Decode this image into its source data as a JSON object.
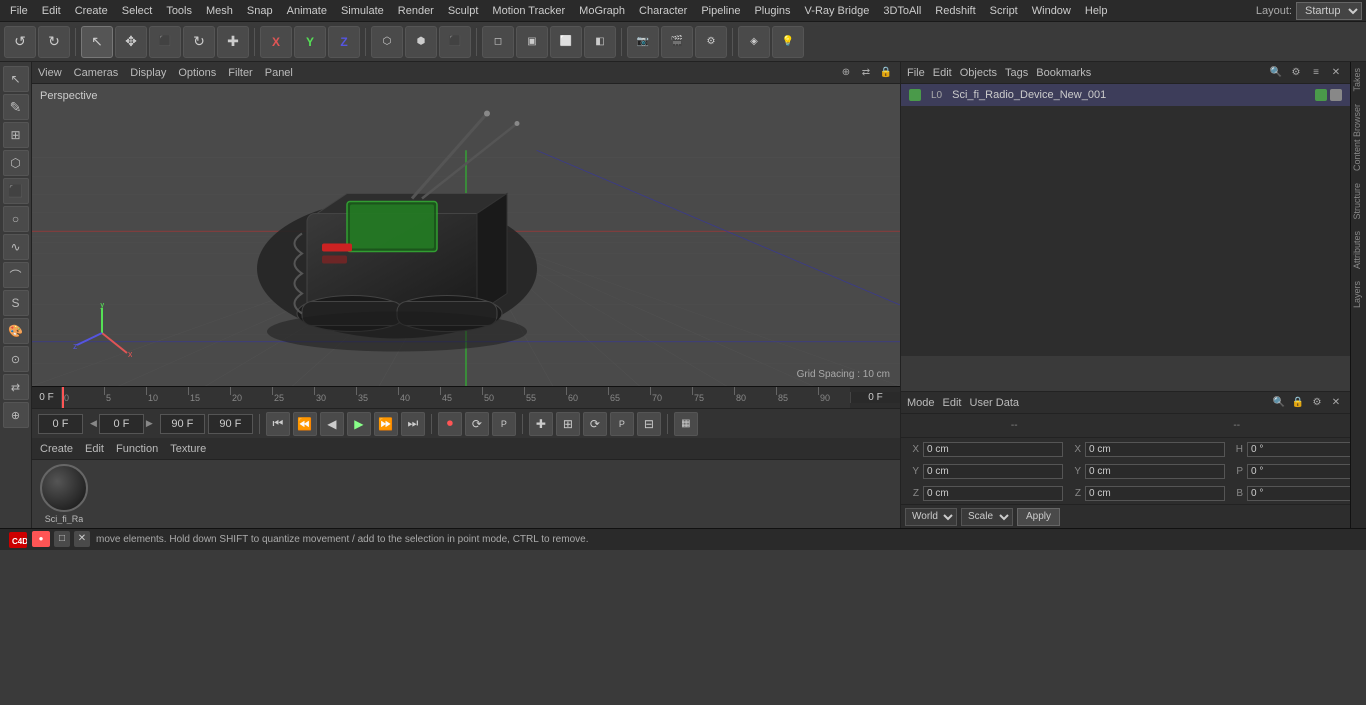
{
  "menubar": {
    "items": [
      "File",
      "Edit",
      "Create",
      "Select",
      "Tools",
      "Mesh",
      "Snap",
      "Animate",
      "Simulate",
      "Render",
      "Sculpt",
      "Motion Tracker",
      "MoGraph",
      "Character",
      "Pipeline",
      "Plugins",
      "V-Ray Bridge",
      "3DToAll",
      "Redshift",
      "Script",
      "Window",
      "Help"
    ],
    "layout_label": "Layout:",
    "layout_value": "Startup"
  },
  "toolbar": {
    "undo_icon": "↺",
    "redo_icon": "↻",
    "tools": [
      "↖",
      "✥",
      "▣",
      "↻",
      "✚"
    ],
    "axes": [
      "X",
      "Y",
      "Z"
    ],
    "modes": [
      "◻",
      "◻",
      "◻",
      "◻",
      "◻",
      "◻",
      "◻",
      "◻",
      "◻",
      "◻"
    ],
    "extras": [
      "◇",
      "◉",
      "⚙",
      "○"
    ]
  },
  "viewport": {
    "perspective_label": "Perspective",
    "menu_items": [
      "View",
      "Cameras",
      "Display",
      "Options",
      "Filter",
      "Panel"
    ],
    "grid_spacing": "Grid Spacing : 10 cm"
  },
  "timeline": {
    "start_frame": "0 F",
    "end_frame": "90 F",
    "current_frame": "0 F",
    "ticks": [
      "0",
      "5",
      "10",
      "15",
      "20",
      "25",
      "30",
      "35",
      "40",
      "45",
      "50",
      "55",
      "60",
      "65",
      "70",
      "75",
      "80",
      "85",
      "90"
    ]
  },
  "playback": {
    "current_frame": "0 F",
    "end_frame": "90 F",
    "min_frame": "0 F",
    "max_frame": "90 F"
  },
  "object_panel": {
    "header_items": [
      "File",
      "Edit",
      "Objects",
      "Tags",
      "Bookmarks"
    ],
    "object": {
      "name": "Sci_fi_Radio_Device_New_001",
      "color": "#4a9a4a",
      "icons": [
        "L0"
      ]
    }
  },
  "attr_panel": {
    "header_items": [
      "Mode",
      "Edit",
      "User Data"
    ],
    "coord_labels": {
      "x_pos": "X",
      "y_pos": "Y",
      "z_pos": "Z",
      "x_size": "X",
      "y_size": "Y",
      "z_size": "Z",
      "h_rot": "H",
      "p_rot": "P",
      "b_rot": "B"
    },
    "coord_values": {
      "x_pos": "0 cm",
      "y_pos": "0 cm",
      "z_pos": "0 cm",
      "x_size": "0 cm",
      "y_size": "0 cm",
      "z_size": "0 cm",
      "h_rot": "0 °",
      "p_rot": "0 °",
      "b_rot": "0 °"
    }
  },
  "tabs": {
    "right_tabs": [
      "Takes",
      "Content Browser",
      "Structure",
      "Attributes",
      "Layers"
    ]
  },
  "bottom_panel": {
    "header_items": [
      "Create",
      "Edit",
      "Function",
      "Texture"
    ],
    "material_name": "Sci_fi_Ra"
  },
  "wsbar": {
    "world_label": "World",
    "scale_label": "Scale",
    "apply_label": "Apply"
  },
  "statusbar": {
    "message": "move elements. Hold down SHIFT to quantize movement / add to the selection in point mode, CTRL to remove."
  }
}
